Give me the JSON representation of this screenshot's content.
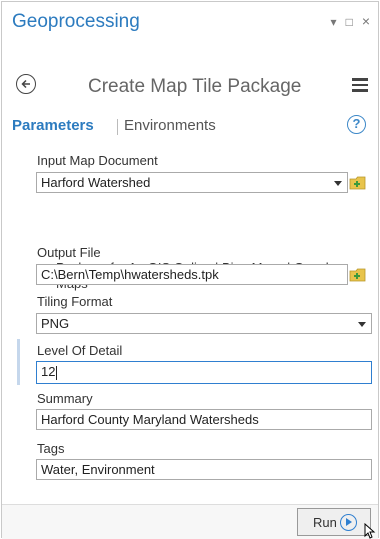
{
  "pane": {
    "title": "Geoprocessing",
    "controls": {
      "pin": "▾",
      "restore": "□",
      "close": "×"
    }
  },
  "tool": {
    "name": "Create Map Tile Package"
  },
  "tabs": {
    "parameters": "Parameters",
    "environments": "Environments",
    "help": "?"
  },
  "params": {
    "input_map": {
      "label": "Input Map Document",
      "value": "Harford Watershed"
    },
    "package_online": {
      "label": "Package for ArcGIS Online | Bing Maps | Google Maps",
      "checked": true
    },
    "output_file": {
      "label": "Output File",
      "value": "C:\\Bern\\Temp\\hwatersheds.tpk"
    },
    "tiling_format": {
      "label": "Tiling Format",
      "value": "PNG"
    },
    "level_of_detail": {
      "label": "Level Of Detail",
      "value": "12"
    },
    "summary": {
      "label": "Summary",
      "value": "Harford County Maryland Watersheds"
    },
    "tags": {
      "label": "Tags",
      "value": "Water, Environment"
    }
  },
  "footer": {
    "run_label": "Run"
  },
  "colors": {
    "accent": "#2c7bbf",
    "active_border": "#2f7fd0"
  }
}
